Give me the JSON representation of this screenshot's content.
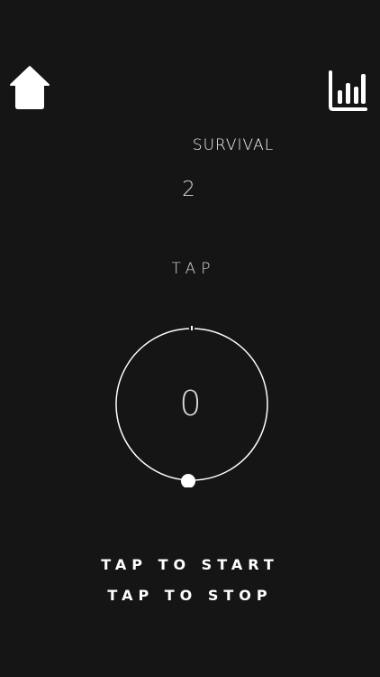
{
  "header": {
    "home_icon": "home-icon",
    "stats_icon": "bar-chart-icon"
  },
  "mode": {
    "label": "SURVIVAL",
    "level": "2"
  },
  "game": {
    "prompt": "TAP",
    "counter": "0"
  },
  "instructions": {
    "start": "TAP TO START",
    "stop": "TAP TO STOP"
  },
  "colors": {
    "background": "#151515",
    "foreground": "#ffffff",
    "muted_text": "#d8d8d8"
  }
}
